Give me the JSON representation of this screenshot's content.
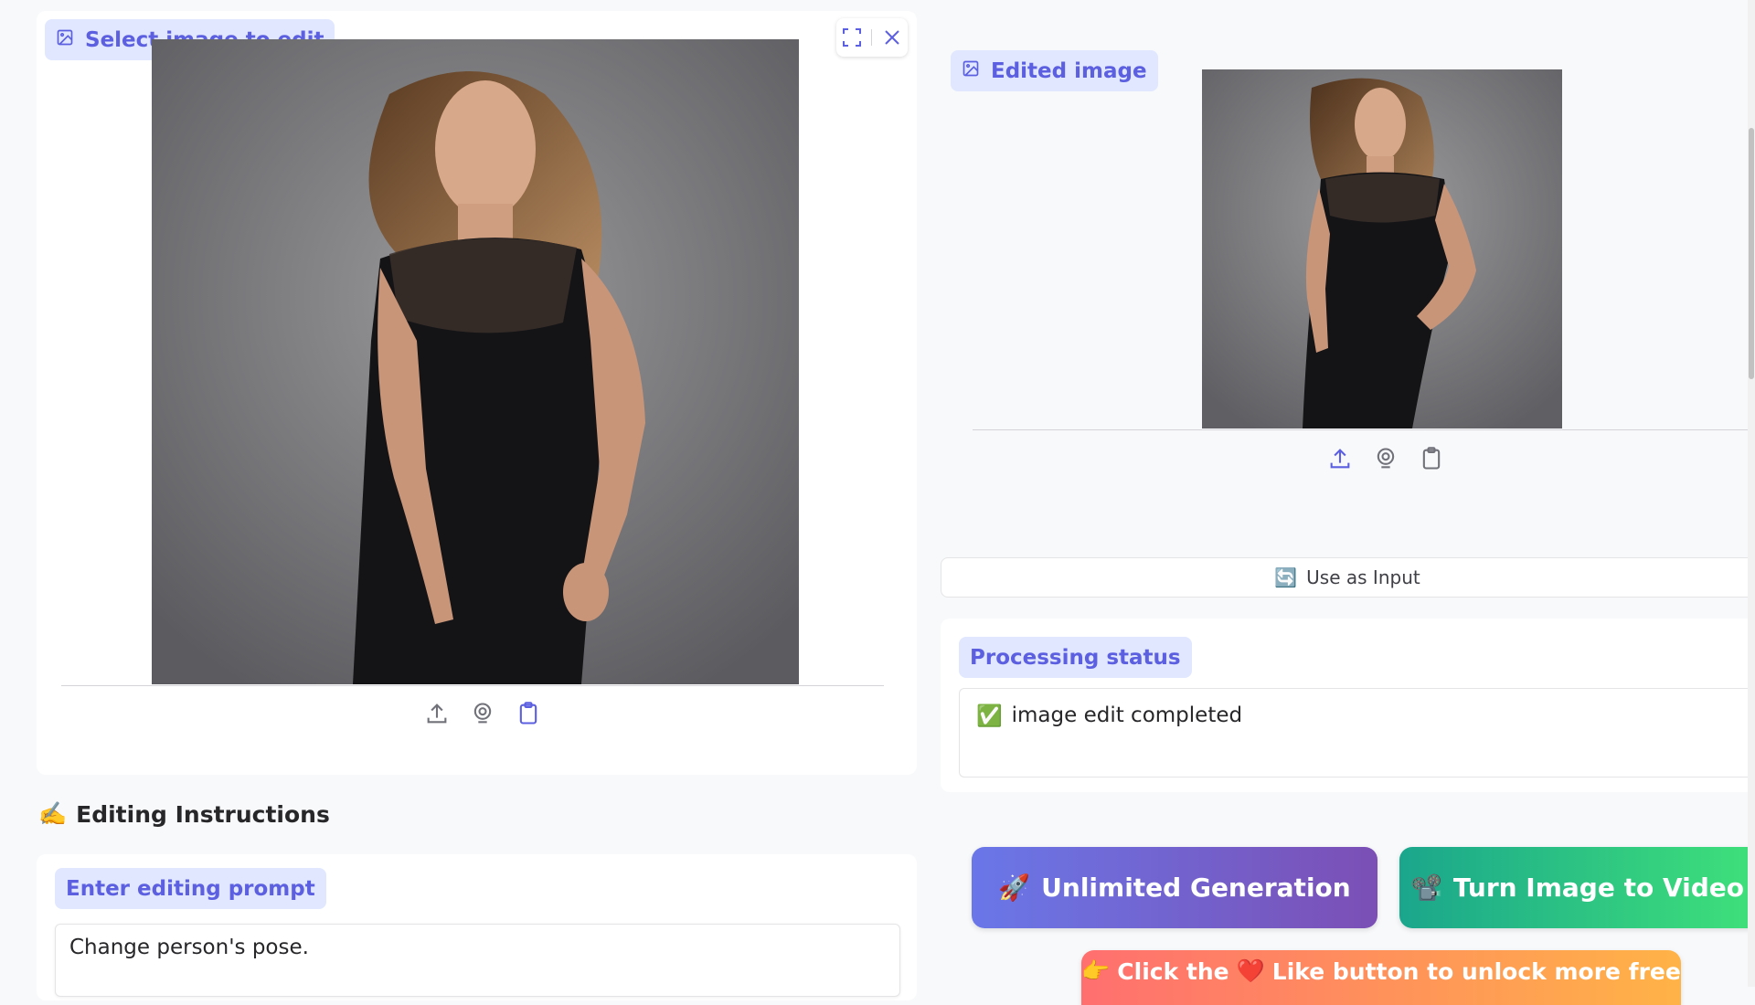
{
  "left_panel": {
    "input_label": "Select image to edit",
    "fullscreen_icon": "fullscreen-icon",
    "close_icon": "close-icon",
    "toolbar_icons": [
      "upload-icon",
      "webcam-icon",
      "clipboard-icon"
    ]
  },
  "instructions": {
    "emoji": "✍️",
    "heading": "Editing Instructions",
    "prompt_label": "Enter editing prompt",
    "prompt_value": "Change person's pose."
  },
  "right_panel": {
    "output_label": "Edited image",
    "toolbar_icons": [
      "upload-icon",
      "webcam-icon",
      "clipboard-icon"
    ],
    "use_input_emoji": "🔄",
    "use_input_label": "Use as Input",
    "status_label": "Processing status",
    "status_emoji": "✅",
    "status_text": "image edit completed"
  },
  "actions": {
    "unlimited_emoji": "🚀",
    "unlimited_label": "Unlimited Generation",
    "video_emoji": "📽️",
    "video_label": "Turn Image to Video",
    "like_prefix_emoji": "👉",
    "like_text_1": "Click the",
    "like_heart": "❤️",
    "like_text_2": "Like button to unlock more free"
  },
  "colors": {
    "accent": "#5b5fe0",
    "chip_bg": "#e0e7ff",
    "unlimited_gradient": [
      "#6a77e8",
      "#7b4fb5"
    ],
    "video_gradient": [
      "#1aa68c",
      "#3fe07a"
    ],
    "like_gradient": [
      "#ff6f6f",
      "#ffb347"
    ]
  }
}
